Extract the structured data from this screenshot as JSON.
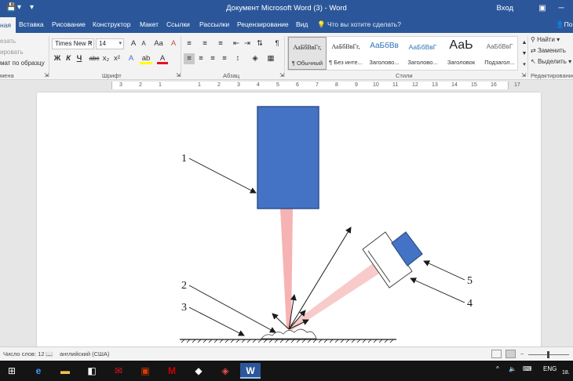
{
  "titlebar": {
    "title": "Документ Microsoft Word (3)  -  Word",
    "login": "Вход",
    "save_icon": "save-icon",
    "undo_icon": "undo-icon",
    "qat_more": "▾",
    "btn_options": "▣",
    "btn_minimize": "─",
    "btn_maximize": "☐"
  },
  "tabs": {
    "file": "ная",
    "items": [
      "Вставка",
      "Рисование",
      "Конструктор",
      "Макет",
      "Ссылки",
      "Рассылки",
      "Рецензирование",
      "Вид"
    ],
    "tell_me": "Что вы хотите сделать?",
    "person": "По"
  },
  "clipboard": {
    "cut": "езать",
    "copy": "ировать",
    "format_painter": "мат по образцу",
    "label": "мена"
  },
  "font": {
    "name": "Times New R",
    "size": "14",
    "grow": "A",
    "shrink": "A",
    "case": "Aa",
    "clear": "A",
    "bold": "Ж",
    "italic": "К",
    "underline": "Ч",
    "strike": "abc",
    "subscript": "x₂",
    "superscript": "x²",
    "effects": "A",
    "highlight": "ab",
    "color": "A",
    "label": "Шрифт"
  },
  "paragraph": {
    "marks": "¶",
    "label": "Абзац"
  },
  "styles": {
    "items": [
      {
        "preview": "АаБбВвГг,",
        "name": "¶ Обычный"
      },
      {
        "preview": "АаБбВвГг,",
        "name": "¶ Без инте..."
      },
      {
        "preview": "АаБбВв",
        "name": "Заголово..."
      },
      {
        "preview": "АаБбВвГ",
        "name": "Заголово..."
      },
      {
        "preview": "АаЬ",
        "name": "Заголовок"
      },
      {
        "preview": "АаБбВвГ",
        "name": "Подзагол..."
      }
    ],
    "label": "Стили"
  },
  "editing": {
    "find": "Найти",
    "replace": "Заменить",
    "select": "Выделить",
    "label": "Редактирование"
  },
  "ruler": {
    "numbers": [
      "3",
      "2",
      "1",
      "1",
      "2",
      "3",
      "4",
      "5",
      "6",
      "7",
      "8",
      "9",
      "10",
      "11",
      "12",
      "13",
      "14",
      "15",
      "16",
      "17"
    ]
  },
  "figure": {
    "labels": [
      "1",
      "2",
      "3",
      "4",
      "5"
    ],
    "colors": {
      "block": "#4472c4",
      "block_border": "#2f528f",
      "beam": "#f4a6a6",
      "line": "#1a1a1a"
    }
  },
  "status": {
    "word_count": "Число слов: 12",
    "language": "английский (США)"
  },
  "taskbar": {
    "items": [
      {
        "glyph": "⊞",
        "name": "start-icon"
      },
      {
        "glyph": "e",
        "name": "edge-icon"
      },
      {
        "glyph": "▬",
        "name": "explorer-icon"
      },
      {
        "glyph": "◧",
        "name": "store-icon"
      },
      {
        "glyph": "✉",
        "name": "mail-icon"
      },
      {
        "glyph": "▣",
        "name": "app-red-icon"
      },
      {
        "glyph": "M",
        "name": "mcafee-icon"
      },
      {
        "glyph": "◆",
        "name": "app-icon"
      },
      {
        "glyph": "◈",
        "name": "app-red2-icon"
      },
      {
        "glyph": "W",
        "name": "word-icon"
      }
    ],
    "language": "ENG",
    "date": "18."
  }
}
